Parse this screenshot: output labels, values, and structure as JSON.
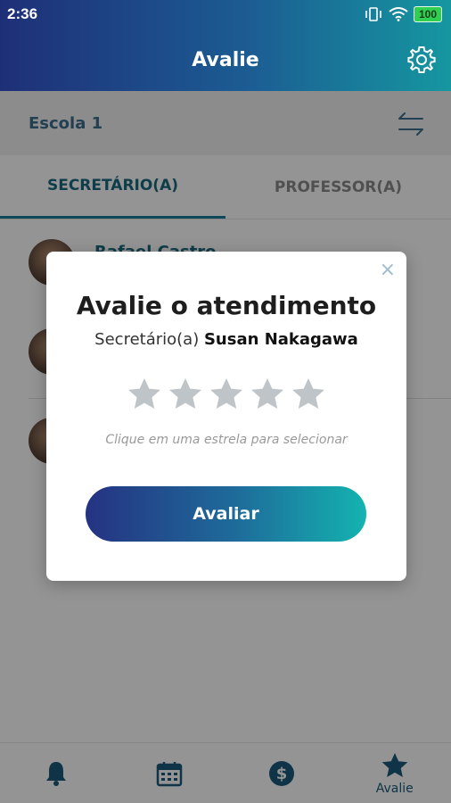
{
  "status_bar": {
    "time": "2:36",
    "battery": "100"
  },
  "app_bar": {
    "title": "Avalie"
  },
  "school": {
    "name": "Escola 1"
  },
  "tabs": [
    {
      "label": "SECRETÁRIO(A)",
      "active": true
    },
    {
      "label": "PROFESSOR(A)",
      "active": false
    }
  ],
  "list": {
    "items": [
      {
        "name": "Rafael Castro"
      }
    ]
  },
  "dialog": {
    "title": "Avalie o atendimento",
    "role": "Secretário(a)",
    "person": "Susan Nakagawa",
    "hint": "Clique em uma estrela para selecionar",
    "button": "Avaliar",
    "close": "×",
    "rating": 0,
    "max_rating": 5
  },
  "bottom_nav": [
    {
      "icon": "bell-icon",
      "label": ""
    },
    {
      "icon": "calendar-icon",
      "label": ""
    },
    {
      "icon": "dollar-icon",
      "label": ""
    },
    {
      "icon": "star-icon",
      "label": "Avalie",
      "active": true
    }
  ],
  "colors": {
    "accent": "#1b6a80",
    "gradient_start": "#1e2f78",
    "gradient_end": "#1597a0",
    "star_inactive": "#bfc4c8"
  }
}
